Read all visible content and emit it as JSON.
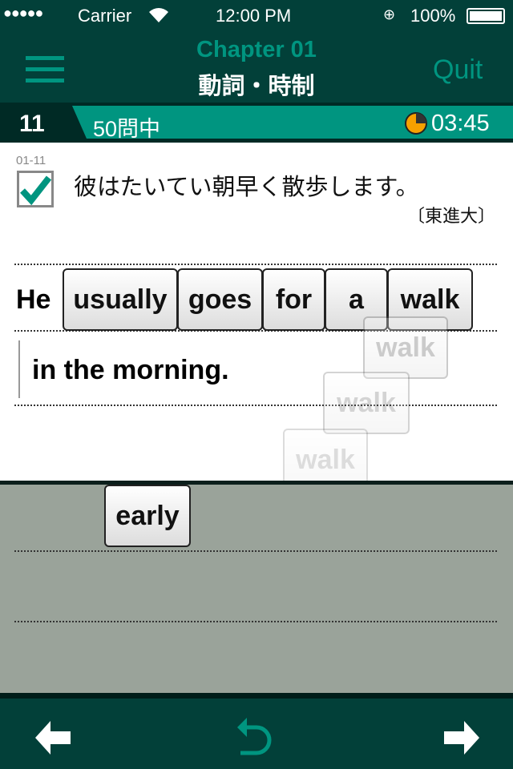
{
  "status_bar": {
    "signal": "●●●●●",
    "carrier": "Carrier",
    "time": "12:00 PM",
    "battery": "100%"
  },
  "header": {
    "chapter": "Chapter 01",
    "title": "動詞・時制",
    "quit_label": "Quit"
  },
  "progress": {
    "question_number": "11",
    "total": "50問中",
    "timer": "03:45",
    "timer_fraction": 0.75
  },
  "question": {
    "id": "01-11",
    "checked": true,
    "prompt": "彼はたいてい朝早く散歩します。",
    "source": "〔東進大〕"
  },
  "answer": {
    "lead": "He",
    "tiles": [
      "usually",
      "goes",
      "for",
      "a",
      "walk"
    ],
    "line2": "in the morning.",
    "dragging": "walk"
  },
  "tray": {
    "tiles": [
      "early"
    ]
  },
  "colors": {
    "header_bg": "#024039",
    "accent": "#009580",
    "timer": "#f7a000"
  }
}
